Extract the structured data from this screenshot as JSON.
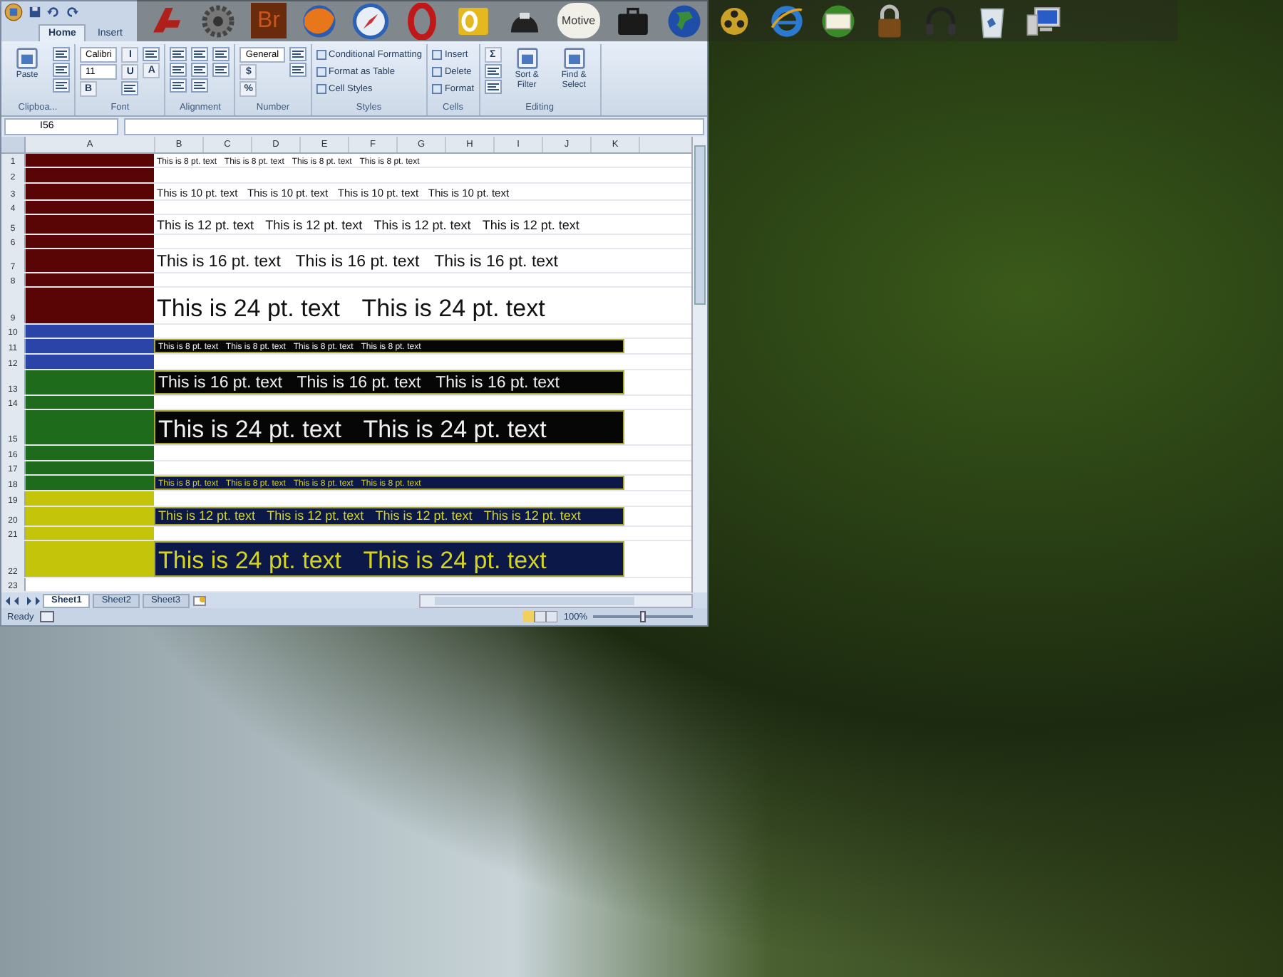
{
  "ribbon_tabs": [
    {
      "label": "Home",
      "selected": true
    },
    {
      "label": "Insert",
      "selected": false
    }
  ],
  "ribbon_groups": [
    {
      "label": "Clipboa...",
      "items": [
        {
          "kind": "big",
          "label": "Paste"
        },
        {
          "kind": "icon"
        },
        {
          "kind": "icon"
        },
        {
          "kind": "icon"
        }
      ]
    },
    {
      "label": "Font",
      "items": [
        {
          "kind": "field",
          "label": "Calibri"
        },
        {
          "kind": "field",
          "label": "11"
        },
        {
          "kind": "glyph",
          "label": "B"
        },
        {
          "kind": "glyph",
          "label": "I"
        },
        {
          "kind": "glyph",
          "label": "U"
        },
        {
          "kind": "icon"
        },
        {
          "kind": "icon"
        },
        {
          "kind": "glyph",
          "label": "A"
        }
      ]
    },
    {
      "label": "Alignment",
      "items": [
        {
          "kind": "icon"
        },
        {
          "kind": "icon"
        },
        {
          "kind": "icon"
        },
        {
          "kind": "icon"
        },
        {
          "kind": "icon"
        },
        {
          "kind": "icon"
        },
        {
          "kind": "icon"
        },
        {
          "kind": "icon"
        }
      ]
    },
    {
      "label": "Number",
      "items": [
        {
          "kind": "field",
          "label": "General"
        },
        {
          "kind": "glyph",
          "label": "$"
        },
        {
          "kind": "glyph",
          "label": "%"
        },
        {
          "kind": "icon"
        },
        {
          "kind": "icon"
        }
      ]
    },
    {
      "label": "Styles",
      "items": [
        {
          "kind": "small",
          "label": "Conditional Formatting"
        },
        {
          "kind": "small",
          "label": "Format as Table"
        },
        {
          "kind": "small",
          "label": "Cell Styles"
        }
      ]
    },
    {
      "label": "Cells",
      "items": [
        {
          "kind": "small",
          "label": "Insert"
        },
        {
          "kind": "small",
          "label": "Delete"
        },
        {
          "kind": "small",
          "label": "Format"
        }
      ]
    },
    {
      "label": "Editing",
      "items": [
        {
          "kind": "glyph",
          "label": "Σ"
        },
        {
          "kind": "icon"
        },
        {
          "kind": "icon"
        },
        {
          "kind": "big",
          "label": "Sort & Filter"
        },
        {
          "kind": "big",
          "label": "Find & Select"
        }
      ]
    }
  ],
  "formula_bar": {
    "name_box": "I56"
  },
  "columns": [
    "A",
    "B",
    "C",
    "D",
    "E",
    "F",
    "G",
    "H",
    "I",
    "J",
    "K"
  ],
  "rows": [
    {
      "number": "1",
      "color": "#5a0505",
      "kind": "plain-tiny",
      "texts": [
        "This is 8 pt. text",
        "This is 8 pt. text",
        "This is 8 pt. text",
        "This is 8 pt. text"
      ]
    },
    {
      "number": "2",
      "color": "#5a0505",
      "kind": "blank",
      "texts": []
    },
    {
      "number": "3",
      "color": "#5a0505",
      "kind": "plain-small",
      "texts": [
        "This is 10 pt. text",
        "This is 10 pt. text",
        "This is 10 pt. text",
        "This is 10 pt. text"
      ]
    },
    {
      "number": "4",
      "color": "#5a0505",
      "kind": "blank",
      "texts": []
    },
    {
      "number": "5",
      "color": "#5a0505",
      "kind": "plain-medium",
      "texts": [
        "This is 12 pt. text",
        "This is 12 pt. text",
        "This is 12 pt. text",
        "This is 12 pt. text"
      ]
    },
    {
      "number": "6",
      "color": "#5a0505",
      "kind": "blank",
      "texts": []
    },
    {
      "number": "7",
      "color": "#5a0505",
      "kind": "plain-large",
      "texts": [
        "This is 16 pt. text",
        "This is 16 pt. text",
        "This is 16 pt. text"
      ]
    },
    {
      "number": "8",
      "color": "#5a0505",
      "kind": "blank",
      "texts": []
    },
    {
      "number": "9",
      "color": "#5a0505",
      "kind": "plain-huge",
      "texts": [
        "This is 24 pt. text",
        "This is 24 pt. text"
      ]
    },
    {
      "number": "10",
      "color": "#2a44a8",
      "kind": "blank",
      "texts": []
    },
    {
      "number": "11",
      "color": "#2a44a8",
      "kind": "black-tiny",
      "texts": [
        "This is 8 pt. text",
        "This is 8 pt. text",
        "This is 8 pt. text",
        "This is 8 pt. text"
      ]
    },
    {
      "number": "12",
      "color": "#2a44a8",
      "kind": "blank",
      "texts": []
    },
    {
      "number": "13",
      "color": "#1f6b1c",
      "kind": "black-large",
      "texts": [
        "This is 16 pt. text",
        "This is 16 pt. text",
        "This is 16 pt. text"
      ]
    },
    {
      "number": "14",
      "color": "#1f6b1c",
      "kind": "blank",
      "texts": []
    },
    {
      "number": "15",
      "color": "#1f6b1c",
      "kind": "black-huge",
      "texts": [
        "This is 24 pt. text",
        "This is 24 pt. text"
      ]
    },
    {
      "number": "16",
      "color": "#1f6b1c",
      "kind": "blank",
      "texts": []
    },
    {
      "number": "17",
      "color": "#1f6b1c",
      "kind": "blank",
      "texts": []
    },
    {
      "number": "18",
      "color": "#1f6b1c",
      "kind": "navy-tiny",
      "texts": [
        "This is 8 pt. text",
        "This is 8 pt. text",
        "This is 8 pt. text",
        "This is 8 pt. text"
      ]
    },
    {
      "number": "19",
      "color": "#c4c40a",
      "kind": "blank",
      "texts": []
    },
    {
      "number": "20",
      "color": "#c4c40a",
      "kind": "navy-medium",
      "texts": [
        "This is 12 pt. text",
        "This is 12 pt. text",
        "This is 12 pt. text",
        "This is 12 pt. text"
      ]
    },
    {
      "number": "21",
      "color": "#c4c40a",
      "kind": "blank",
      "texts": []
    },
    {
      "number": "22",
      "color": "#c4c40a",
      "kind": "navy-huge",
      "texts": [
        "This is 24 pt. text",
        "This is 24 pt. text"
      ]
    },
    {
      "number": "23",
      "kind": "blank",
      "texts": []
    }
  ],
  "sheet_tabs": [
    {
      "label": "Sheet1",
      "selected": true
    },
    {
      "label": "Sheet2",
      "selected": false
    },
    {
      "label": "Sheet3",
      "selected": false
    }
  ],
  "status_bar": {
    "status": "Ready",
    "zoom": "100%",
    "zoom_slider": {
      "level": 0.5
    }
  },
  "dock": [
    {
      "kind": "logo"
    },
    {
      "kind": "gear"
    },
    {
      "kind": "tile",
      "label": "Br"
    },
    {
      "kind": "browser"
    },
    {
      "kind": "compass"
    },
    {
      "kind": "ring"
    },
    {
      "kind": "mail"
    },
    {
      "kind": "mouse"
    },
    {
      "kind": "labelled",
      "label": "Motive"
    },
    {
      "kind": "briefcase"
    },
    {
      "kind": "globe"
    },
    {
      "kind": "reel"
    },
    {
      "kind": "browser-e"
    },
    {
      "kind": "envelope"
    },
    {
      "kind": "padlock"
    },
    {
      "kind": "headphones"
    },
    {
      "kind": "trash"
    },
    {
      "kind": "monitor"
    }
  ]
}
